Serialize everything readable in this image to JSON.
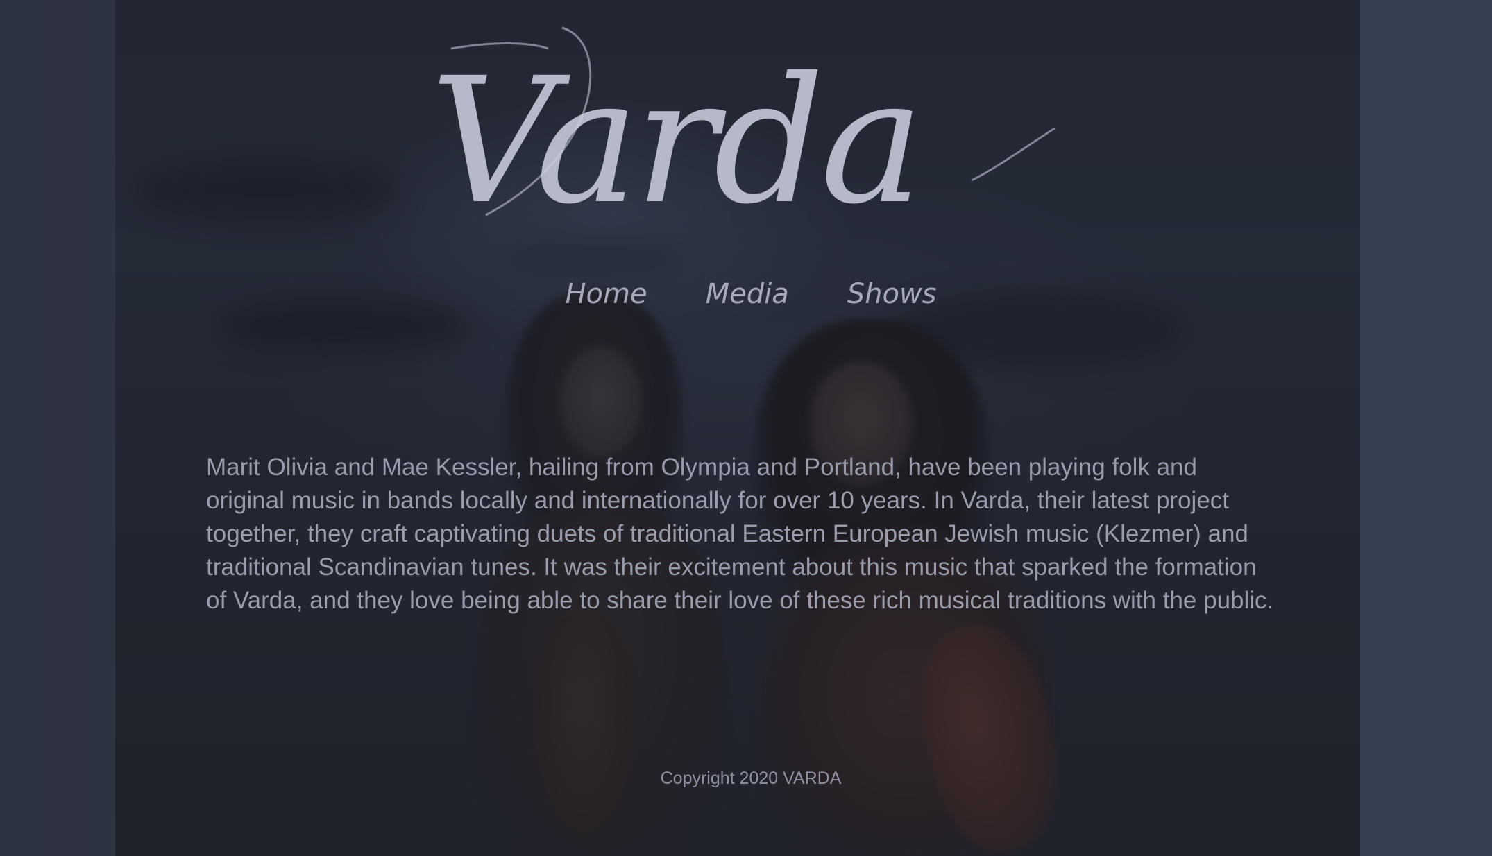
{
  "brand": {
    "logo_text": "Varda"
  },
  "nav": {
    "items": [
      {
        "label": "Home"
      },
      {
        "label": "Media"
      },
      {
        "label": "Shows"
      }
    ]
  },
  "about": {
    "text": "Marit Olivia and Mae Kessler, hailing from Olympia and Portland, have been playing folk and original music in bands locally and internationally for over 10 years. In Varda, their latest project together, they craft captivating duets of traditional Eastern European Jewish music (Klezmer) and traditional Scandinavian tunes. It was their excitement about this music that sparked the formation of Varda, and they love being able to share their love of these rich musical traditions with the public."
  },
  "footer": {
    "copyright": "Copyright 2020 VARDA"
  },
  "colors": {
    "page_background": "#2f3443",
    "logo": "#b7b9cb",
    "nav_text": "#a8aab9",
    "body_text": "#9a9cac"
  }
}
